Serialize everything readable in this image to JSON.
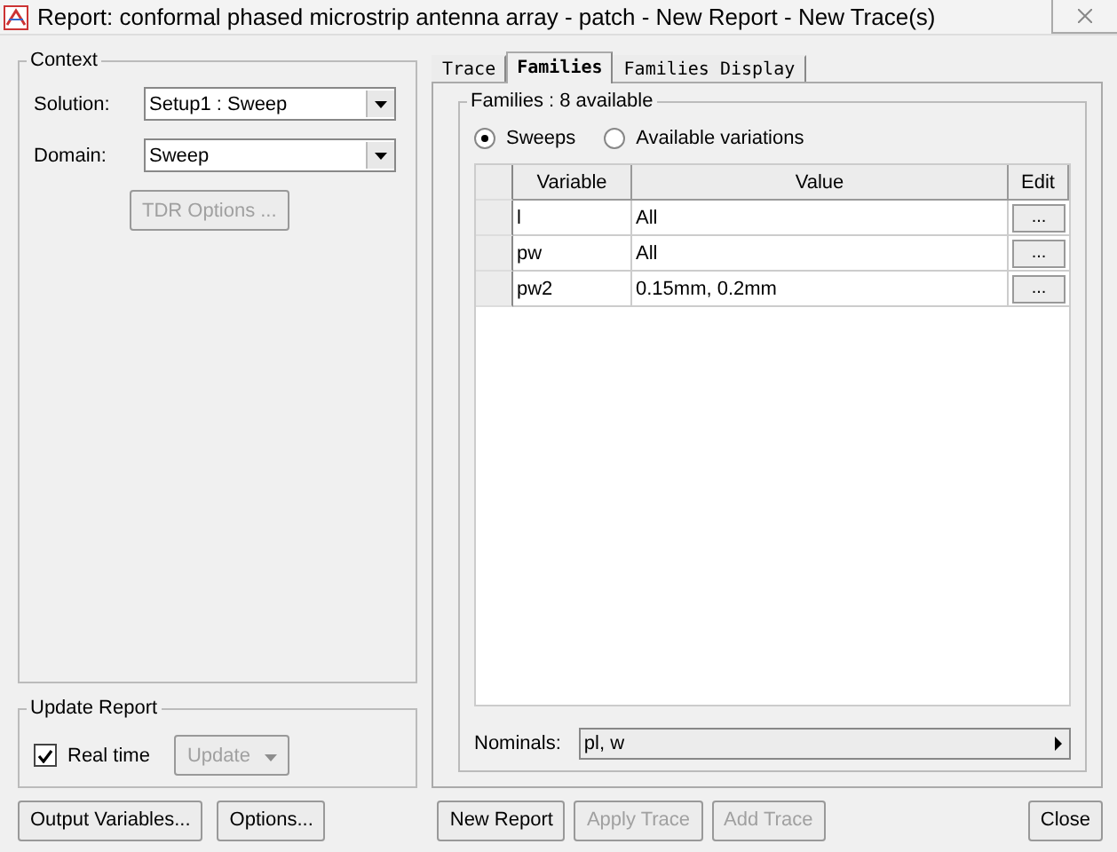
{
  "window": {
    "title": "Report: conformal phased microstrip antenna array - patch - New Report - New Trace(s)"
  },
  "context": {
    "title": "Context",
    "solution": {
      "label": "Solution:",
      "value": "Setup1 : Sweep"
    },
    "domain": {
      "label": "Domain:",
      "value": "Sweep"
    },
    "tdr_button": {
      "label": "TDR Options ...",
      "disabled": true
    }
  },
  "update_report": {
    "title": "Update Report",
    "real_time": {
      "label": "Real time",
      "checked": true
    },
    "update_button": {
      "label": "Update",
      "disabled": true
    }
  },
  "tabs": [
    {
      "label": "Trace",
      "selected": false
    },
    {
      "label": "Families",
      "selected": true
    },
    {
      "label": "Families Display",
      "selected": false
    }
  ],
  "families": {
    "title": "Families : 8 available",
    "radios": [
      {
        "label": "Sweeps",
        "selected": true
      },
      {
        "label": "Available variations",
        "selected": false
      }
    ],
    "table": {
      "columns": [
        "Variable",
        "Value",
        "Edit"
      ],
      "rows": [
        {
          "variable": "l",
          "value": "All",
          "edit": "..."
        },
        {
          "variable": "pw",
          "value": "All",
          "edit": "..."
        },
        {
          "variable": "pw2",
          "value": "0.15mm, 0.2mm",
          "edit": "..."
        }
      ]
    },
    "nominals": {
      "label": "Nominals:",
      "value": "pl, w"
    }
  },
  "buttons": [
    {
      "label": "Output Variables...",
      "disabled": false
    },
    {
      "label": "Options...",
      "disabled": false
    },
    {
      "label": "New Report",
      "disabled": false
    },
    {
      "label": "Apply Trace",
      "disabled": true
    },
    {
      "label": "Add Trace",
      "disabled": true
    },
    {
      "label": "Close",
      "disabled": false
    }
  ]
}
